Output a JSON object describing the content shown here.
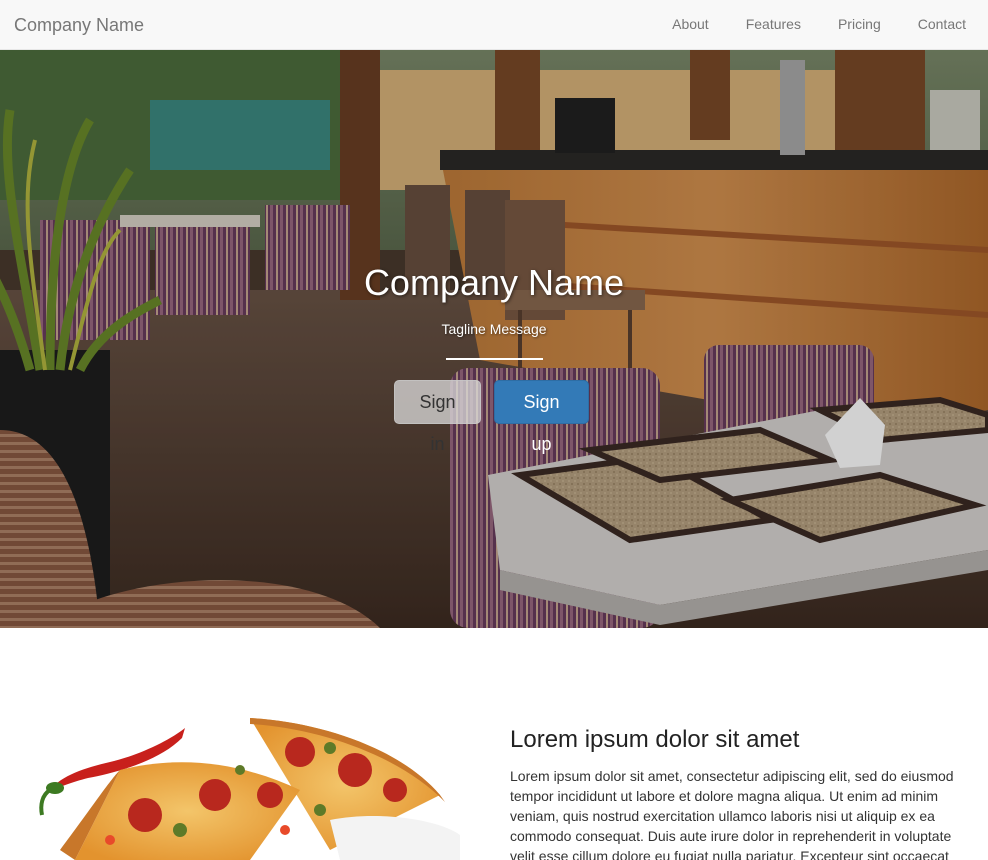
{
  "navbar": {
    "brand": "Company Name",
    "links": [
      {
        "label": "About"
      },
      {
        "label": "Features"
      },
      {
        "label": "Pricing"
      },
      {
        "label": "Contact"
      }
    ]
  },
  "hero": {
    "title": "Company Name",
    "tagline": "Tagline Message",
    "signin_label": "Sign in",
    "signup_label": "Sign up"
  },
  "feature": {
    "title": "Lorem ipsum dolor sit amet",
    "text": "Lorem ipsum dolor sit amet, consectetur adipiscing elit, sed do eiusmod tempor incididunt ut labore et dolore magna aliqua. Ut enim ad minim veniam, quis nostrud exercitation ullamco laboris nisi ut aliquip ex ea commodo consequat. Duis aute irure dolor in reprehenderit in voluptate velit esse cillum dolore eu fugiat nulla pariatur. Excepteur sint occaecat"
  },
  "colors": {
    "navbar_bg": "#f8f8f8",
    "primary": "#337ab7",
    "nav_text": "#777777"
  }
}
